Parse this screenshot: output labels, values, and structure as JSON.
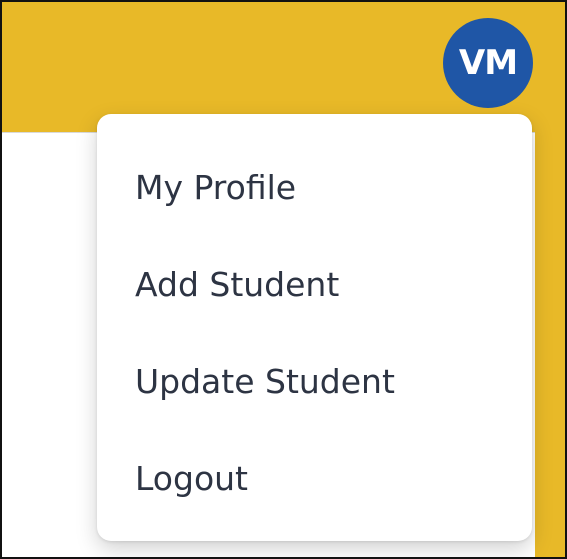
{
  "header": {
    "avatar_initials": "VM",
    "accent_color": "#e8b928",
    "avatar_color": "#1f56a6"
  },
  "menu": {
    "items": [
      {
        "label": "My Profile"
      },
      {
        "label": "Add Student"
      },
      {
        "label": "Update Student"
      },
      {
        "label": "Logout"
      }
    ]
  }
}
